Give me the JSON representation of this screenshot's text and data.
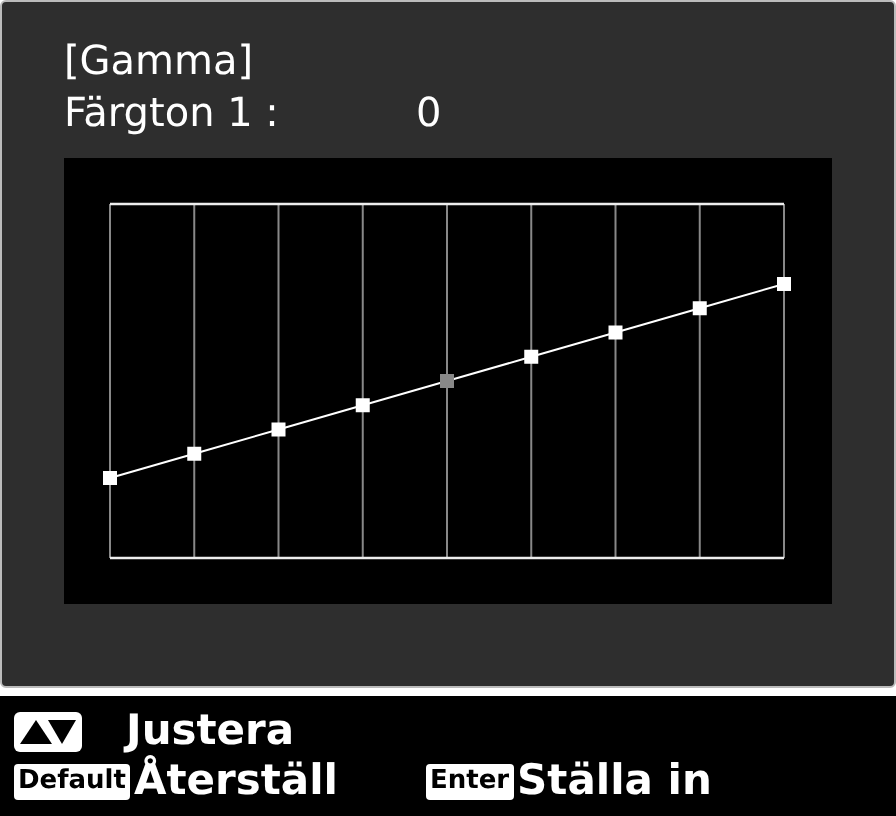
{
  "title": "[Gamma]",
  "setting": {
    "label": "Färgton 1 :",
    "value": "0"
  },
  "curve": {
    "points": [
      {
        "selected": false
      },
      {
        "selected": false
      },
      {
        "selected": false
      },
      {
        "selected": false
      },
      {
        "selected": true
      },
      {
        "selected": false
      },
      {
        "selected": false
      },
      {
        "selected": false
      },
      {
        "selected": false
      }
    ]
  },
  "help": [
    {
      "kind": "arrows",
      "label": "Justera"
    },
    {
      "kind": "key",
      "key": "Default",
      "label": "Återställ"
    },
    {
      "kind": "key",
      "key": "Enter",
      "label": "Ställa in"
    }
  ]
}
